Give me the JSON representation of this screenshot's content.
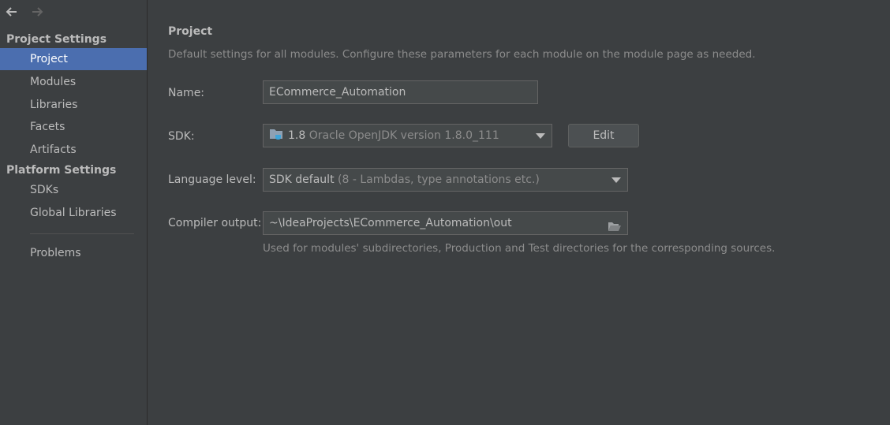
{
  "sidebar": {
    "back_icon": "arrow-left-icon",
    "forward_icon": "arrow-right-icon",
    "project_settings_title": "Project Settings",
    "project_items": [
      {
        "label": "Project",
        "selected": true
      },
      {
        "label": "Modules"
      },
      {
        "label": "Libraries"
      },
      {
        "label": "Facets"
      },
      {
        "label": "Artifacts"
      }
    ],
    "platform_settings_title": "Platform Settings",
    "platform_items": [
      {
        "label": "SDKs"
      },
      {
        "label": "Global Libraries"
      }
    ],
    "problems_label": "Problems"
  },
  "main": {
    "title": "Project",
    "description": "Default settings for all modules. Configure these parameters for each module on the module page as needed.",
    "name_label": "Name:",
    "name_value": "ECommerce_Automation",
    "sdk_label": "SDK:",
    "sdk_version": "1.8",
    "sdk_detail": "Oracle OpenJDK version 1.8.0_111",
    "sdk_icon": "folder-cup-icon",
    "edit_label": "Edit",
    "language_level_label": "Language level:",
    "language_level_value": "SDK default",
    "language_level_detail": "(8 - Lambdas, type annotations etc.)",
    "compiler_output_label": "Compiler output:",
    "compiler_output_value": "~\\IdeaProjects\\ECommerce_Automation\\out",
    "compiler_output_hint": "Used for modules' subdirectories, Production and Test directories for the corresponding sources.",
    "browse_icon": "open-folder-icon"
  },
  "colors": {
    "background": "#3c3f41",
    "selection": "#4b6eaf",
    "field_background": "#45494a",
    "text": "#bbbbbb",
    "muted_text": "#8c8c8c"
  }
}
